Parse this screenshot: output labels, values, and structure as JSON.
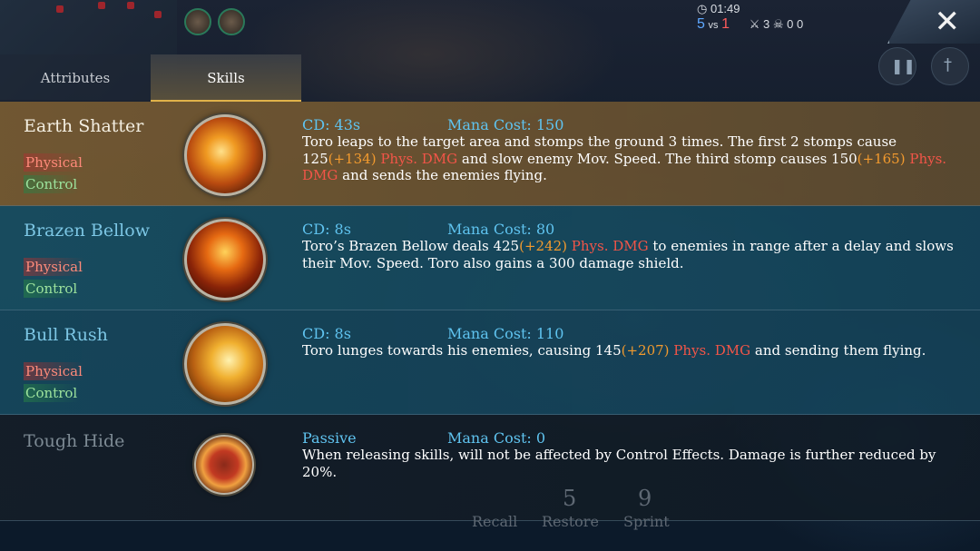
{
  "hud": {
    "timer": "01:49",
    "score_left": "5",
    "score_vs": "vs",
    "score_right": "1",
    "kills": "3",
    "deaths": "0",
    "assists": "0",
    "close_label": "✕"
  },
  "tabs": [
    {
      "label": "Attributes",
      "active": false
    },
    {
      "label": "Skills",
      "active": true
    }
  ],
  "skills": [
    {
      "name": "Earth Shatter",
      "tags": [
        "Physical",
        "Control"
      ],
      "cd_label": "CD: 43s",
      "mana_label": "Mana Cost: 150",
      "desc_parts": [
        {
          "text": "Toro leaps to the target area and stomps the ground 3 times. The first 2 stomps cause 125",
          "style": "plain"
        },
        {
          "text": "(+134)",
          "style": "orange"
        },
        {
          "text": " Phys. DMG",
          "style": "red"
        },
        {
          "text": " and slow enemy Mov. Speed. The third stomp causes 150",
          "style": "plain"
        },
        {
          "text": "(+165)",
          "style": "orange"
        },
        {
          "text": " Phys. DMG",
          "style": "red"
        },
        {
          "text": " and sends the enemies flying.",
          "style": "plain"
        }
      ],
      "icon": "earth-shatter-icon"
    },
    {
      "name": "Brazen Bellow",
      "tags": [
        "Physical",
        "Control"
      ],
      "cd_label": "CD: 8s",
      "mana_label": "Mana Cost: 80",
      "desc_parts": [
        {
          "text": "Toro’s Brazen Bellow deals 425",
          "style": "plain"
        },
        {
          "text": "(+242)",
          "style": "orange"
        },
        {
          "text": " Phys. DMG",
          "style": "red"
        },
        {
          "text": " to enemies in range after a delay and slows their Mov. Speed. Toro also gains a 300 damage shield.",
          "style": "plain"
        }
      ],
      "icon": "brazen-bellow-icon"
    },
    {
      "name": "Bull Rush",
      "tags": [
        "Physical",
        "Control"
      ],
      "cd_label": "CD: 8s",
      "mana_label": "Mana Cost: 110",
      "desc_parts": [
        {
          "text": "Toro lunges towards his enemies, causing 145",
          "style": "plain"
        },
        {
          "text": "(+207)",
          "style": "orange"
        },
        {
          "text": " Phys. DMG",
          "style": "red"
        },
        {
          "text": " and sending them flying.",
          "style": "plain"
        }
      ],
      "icon": "bull-rush-icon"
    },
    {
      "name": "Tough Hide",
      "tags": [],
      "cd_label": "Passive",
      "mana_label": "Mana Cost: 0",
      "desc_parts": [
        {
          "text": "When releasing skills, will not be affected by Control Effects. Damage is further reduced by 20%.",
          "style": "plain"
        }
      ],
      "icon": "tough-hide-icon"
    }
  ],
  "bottom_buttons": [
    "Recall",
    "Restore",
    "Sprint"
  ],
  "bottom_numbers": [
    "5",
    "9"
  ]
}
